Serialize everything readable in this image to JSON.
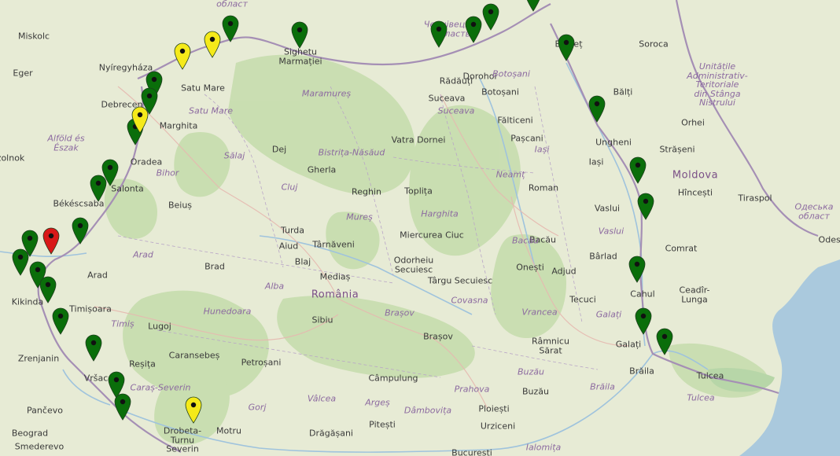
{
  "map": {
    "city_labels": [
      {
        "text": "Miskolc"
      },
      {
        "text": "Eger"
      },
      {
        "text": "Nyíregyháza"
      },
      {
        "text": "Debrecen"
      },
      {
        "text": "Satu Mare"
      },
      {
        "text": "Sighetu Marmației"
      },
      {
        "text": "Marghita"
      },
      {
        "text": "Oradea"
      },
      {
        "text": "Salonta"
      },
      {
        "text": "Békéscsaba"
      },
      {
        "text": "Beiuș"
      },
      {
        "text": "Arad"
      },
      {
        "text": "Timișoara"
      },
      {
        "text": "Lugoj"
      },
      {
        "text": "Reșița"
      },
      {
        "text": "Caransebeș"
      },
      {
        "text": "Zrenjanin"
      },
      {
        "text": "Vršac"
      },
      {
        "text": "Pančevo"
      },
      {
        "text": "Beograd"
      },
      {
        "text": "Smederevo"
      },
      {
        "text": "Kikinda"
      },
      {
        "text": "Drobeta-Turnu Severin"
      },
      {
        "text": "Motru"
      },
      {
        "text": "Petroșani"
      },
      {
        "text": "Dej"
      },
      {
        "text": "Gherla"
      },
      {
        "text": "Reghin"
      },
      {
        "text": "Toplița"
      },
      {
        "text": "Turda"
      },
      {
        "text": "Aiud"
      },
      {
        "text": "Blaj"
      },
      {
        "text": "Târnăveni"
      },
      {
        "text": "Mediaș"
      },
      {
        "text": "Brad"
      },
      {
        "text": "Sibiu"
      },
      {
        "text": "Odorheiu Secuiesc"
      },
      {
        "text": "Miercurea Ciuc"
      },
      {
        "text": "Târgu Secuiesc"
      },
      {
        "text": "Brașov"
      },
      {
        "text": "Câmpulung"
      },
      {
        "text": "Pitești"
      },
      {
        "text": "Drăgășani"
      },
      {
        "text": "Ploiești"
      },
      {
        "text": "Urziceni"
      },
      {
        "text": "București"
      },
      {
        "text": "Buzău"
      },
      {
        "text": "Râmnicu Sărat"
      },
      {
        "text": "Onești"
      },
      {
        "text": "Adjud"
      },
      {
        "text": "Bacău"
      },
      {
        "text": "Roman"
      },
      {
        "text": "Tecuci"
      },
      {
        "text": "Bârlad"
      },
      {
        "text": "Vaslui"
      },
      {
        "text": "Iași"
      },
      {
        "text": "Pașcani"
      },
      {
        "text": "Fălticeni"
      },
      {
        "text": "Suceava"
      },
      {
        "text": "Rădăuți"
      },
      {
        "text": "Botoșani"
      },
      {
        "text": "Dorohoi"
      },
      {
        "text": "Vatra Dornei"
      },
      {
        "text": "Brăila"
      },
      {
        "text": "Galați"
      },
      {
        "text": "Cahul"
      },
      {
        "text": "Tulcea"
      },
      {
        "text": "Comrat"
      },
      {
        "text": "Ceadîr-Lunga"
      },
      {
        "text": "Hîncești"
      },
      {
        "text": "Tiraspol"
      },
      {
        "text": "Strășeni"
      },
      {
        "text": "Orhei"
      },
      {
        "text": "Ungheni"
      },
      {
        "text": "Bălți"
      },
      {
        "text": "Soroca"
      },
      {
        "text": "Edineț"
      },
      {
        "text": "Szolnok"
      },
      {
        "text": "Odesa"
      }
    ],
    "region_labels": [
      {
        "text": "Maramureș"
      },
      {
        "text": "Satu Mare"
      },
      {
        "text": "Sălaj"
      },
      {
        "text": "Bistrița-Năsăud"
      },
      {
        "text": "Bihor"
      },
      {
        "text": "Cluj"
      },
      {
        "text": "Mureș"
      },
      {
        "text": "Harghita"
      },
      {
        "text": "Neamț"
      },
      {
        "text": "Iași"
      },
      {
        "text": "Botoșani"
      },
      {
        "text": "Suceava"
      },
      {
        "text": "Vaslui"
      },
      {
        "text": "Bacău"
      },
      {
        "text": "Covasna"
      },
      {
        "text": "Vrancea"
      },
      {
        "text": "Galați"
      },
      {
        "text": "Brăila"
      },
      {
        "text": "Tulcea"
      },
      {
        "text": "Buzău"
      },
      {
        "text": "Prahova"
      },
      {
        "text": "Dâmbovița"
      },
      {
        "text": "Argeș"
      },
      {
        "text": "Vâlcea"
      },
      {
        "text": "Gorj"
      },
      {
        "text": "Caraș-Severin"
      },
      {
        "text": "Hunedoara"
      },
      {
        "text": "Alba"
      },
      {
        "text": "Timiș"
      },
      {
        "text": "Arad"
      },
      {
        "text": "Brașov"
      },
      {
        "text": "Ialomița"
      },
      {
        "text": "Alföld és Észak"
      },
      {
        "text": "Чернівецька область"
      },
      {
        "text": "област"
      },
      {
        "text": "Unitățile Administrativ-Teritoriale din Stânga Nistrului"
      },
      {
        "text": "Одеська област"
      }
    ],
    "country_labels": [
      {
        "text": "România"
      },
      {
        "text": "Moldova"
      }
    ],
    "markers": [
      {
        "status": "green"
      },
      {
        "status": "green"
      },
      {
        "status": "green"
      },
      {
        "status": "green"
      },
      {
        "status": "green"
      },
      {
        "status": "green"
      },
      {
        "status": "green"
      },
      {
        "status": "green"
      },
      {
        "status": "green"
      },
      {
        "status": "green"
      },
      {
        "status": "green"
      },
      {
        "status": "green"
      },
      {
        "status": "green"
      },
      {
        "status": "green"
      },
      {
        "status": "green"
      },
      {
        "status": "green"
      },
      {
        "status": "green"
      },
      {
        "status": "green"
      },
      {
        "status": "green"
      },
      {
        "status": "green"
      },
      {
        "status": "green"
      },
      {
        "status": "green"
      },
      {
        "status": "green"
      },
      {
        "status": "green"
      },
      {
        "status": "green"
      },
      {
        "status": "green"
      },
      {
        "status": "green"
      },
      {
        "status": "yellow"
      },
      {
        "status": "yellow"
      },
      {
        "status": "yellow"
      },
      {
        "status": "yellow"
      },
      {
        "status": "red"
      }
    ],
    "colors": {
      "green": "#0a6e0a",
      "yellow": "#f5ea1a",
      "red": "#d81818",
      "water": "#a9cbe0",
      "land": "#e6ead3",
      "forest": "#c5dcac",
      "border": "#a58fb5"
    }
  }
}
